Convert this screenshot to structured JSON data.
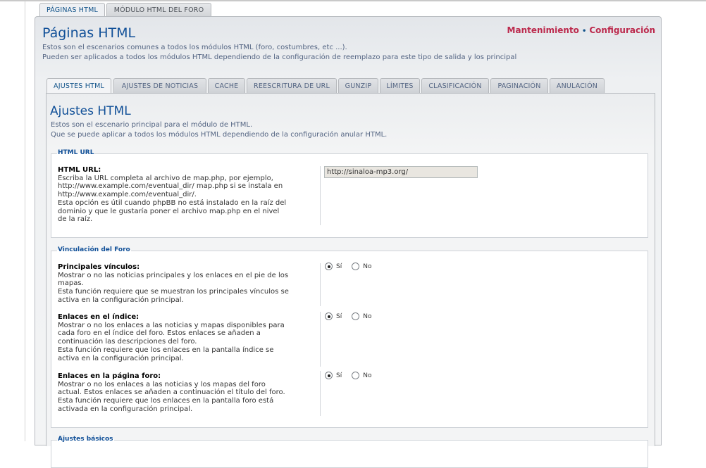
{
  "top_tabs": [
    {
      "label": "PÁGINAS HTML",
      "active": true
    },
    {
      "label": "MÓDULO HTML DEL FORO",
      "active": false
    }
  ],
  "page": {
    "title": "Páginas HTML",
    "desc_line1": "Estos son el escenarios comunes a todos los módulos HTML (foro, costumbres, etc ...).",
    "desc_line2": "Pueden ser aplicados a todos los módulos HTML dependiendo de la configuración de reemplazo para este tipo de salida y los principal",
    "links": {
      "maintenance": "Mantenimiento",
      "separator": "•",
      "configuration": "Configuración"
    }
  },
  "inner_tabs": [
    {
      "label": "AJUSTES HTML",
      "active": true
    },
    {
      "label": "AJUSTES DE NOTICIAS",
      "active": false
    },
    {
      "label": "CACHE",
      "active": false
    },
    {
      "label": "REESCRITURA DE URL",
      "active": false
    },
    {
      "label": "GUNZIP",
      "active": false
    },
    {
      "label": "LÍMITES",
      "active": false
    },
    {
      "label": "CLASIFICACIÓN",
      "active": false
    },
    {
      "label": "PAGINACIÓN",
      "active": false
    },
    {
      "label": "ANULACIÓN",
      "active": false
    }
  ],
  "section": {
    "title": "Ajustes HTML",
    "desc_line1": "Estos son el escenario principal para el módulo de HTML.",
    "desc_line2": "Que se puede aplicar a todos los módulos HTML dependiendo de la configuración anular HTML."
  },
  "fieldset_url": {
    "legend": "HTML URL",
    "field": {
      "label": "HTML URL:",
      "description": [
        "Escriba la URL completa al archivo de map.php, por ejemplo,",
        "http://www.example.com/eventual_dir/ map.php si se instala en",
        "http://www.example.com/eventual_dir/.",
        "Esta opción es útil cuando phpBB no está instalado en la raíz del",
        "dominio y que le gustaría poner el archivo map.php en el nivel",
        "de la raíz."
      ],
      "value": "http://sinaloa-mp3.org/"
    }
  },
  "fieldset_links": {
    "legend": "Vinculación del Foro",
    "radio_yes": "Sí",
    "radio_no": "No",
    "fields": [
      {
        "label": "Principales vínculos:",
        "description": [
          "Mostrar o no las noticias principales y los enlaces en el pie de los",
          "mapas.",
          "Esta función requiere que se muestran los principales vínculos se",
          "activa en la configuración principal."
        ],
        "selected": "yes"
      },
      {
        "label": "Enlaces en el índice:",
        "description": [
          "Mostrar o no los enlaces a las noticias y mapas disponibles para",
          "cada foro en el índice del foro. Estos enlaces se añaden a",
          "continuación las descripciones del foro.",
          "Esta función requiere que los enlaces en la pantalla índice se",
          "activa en la configuración principal."
        ],
        "selected": "yes"
      },
      {
        "label": "Enlaces en la página foro:",
        "description": [
          "Mostrar o no los enlaces a las noticias y los mapas del foro",
          "actual. Estos enlaces se añaden a continuación el título del foro.",
          "Esta función requiere que los enlaces en la pantalla foro está",
          "activada en la configuración principal."
        ],
        "selected": "yes"
      }
    ]
  },
  "fieldset_basic": {
    "legend": "Ajustes básicos"
  }
}
